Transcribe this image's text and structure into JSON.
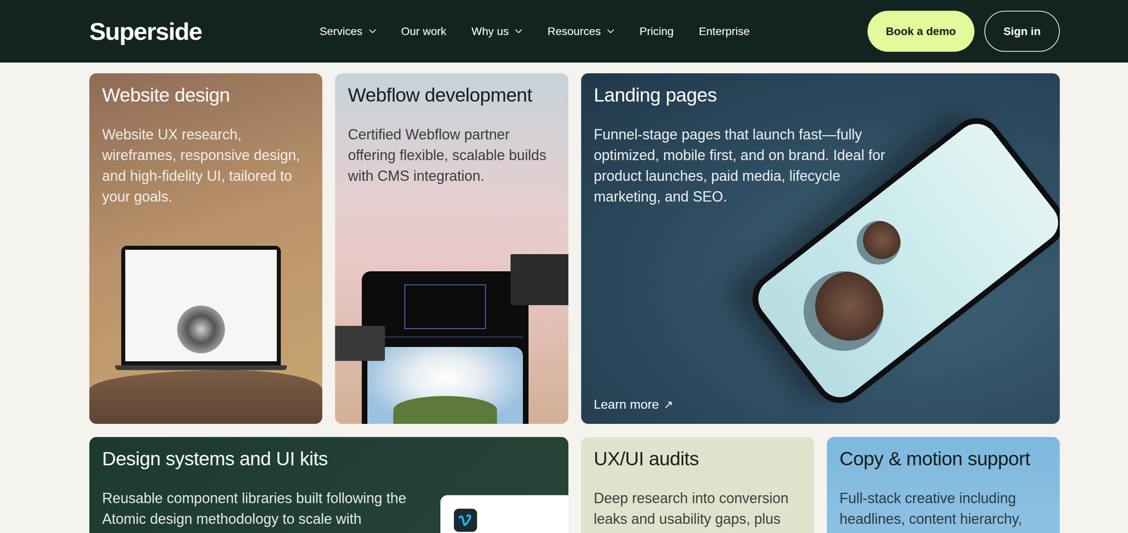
{
  "brand": {
    "logo": "Superside"
  },
  "nav": {
    "items": [
      {
        "label": "Services",
        "dropdown": true
      },
      {
        "label": "Our work",
        "dropdown": false
      },
      {
        "label": "Why us",
        "dropdown": true
      },
      {
        "label": "Resources",
        "dropdown": true
      },
      {
        "label": "Pricing",
        "dropdown": false
      },
      {
        "label": "Enterprise",
        "dropdown": false
      }
    ],
    "actions": [
      {
        "label": "Book a demo",
        "kind": "primary"
      },
      {
        "label": "Sign in",
        "kind": "outline"
      }
    ]
  },
  "cards": [
    {
      "title": "Website design",
      "description_lines": [
        "Website UX research,",
        "wireframes, responsive design,",
        "and high-fidelity UI, tailored to",
        "your goals."
      ],
      "kind": "laptop"
    },
    {
      "title": "Webflow development",
      "description_lines": [
        "Certified Webflow partner",
        "offering flexible, scalable builds",
        "with CMS integration."
      ],
      "kind": "webflow"
    },
    {
      "title": "Landing pages",
      "description_lines": [
        "Funnel-stage pages that launch fast—fully",
        "optimized, mobile first, and on brand. Ideal for",
        "product launches, paid media, lifecycle",
        "marketing, and SEO."
      ],
      "kind": "phone",
      "link": {
        "label": "Learn more",
        "icon": "↗"
      }
    },
    {
      "title": "Design systems and UI kits",
      "description_lines": [
        "Reusable component libraries built following the",
        "Atomic design methodology to scale with"
      ],
      "kind": "library"
    },
    {
      "title": "UX/UI audits",
      "description_lines": [
        "Deep research into conversion",
        "leaks and usability gaps, plus"
      ],
      "kind": "plain"
    },
    {
      "title": "Copy & motion support",
      "description_lines": [
        "Full-stack creative including",
        "headlines, content hierarchy,"
      ],
      "kind": "sky"
    }
  ]
}
